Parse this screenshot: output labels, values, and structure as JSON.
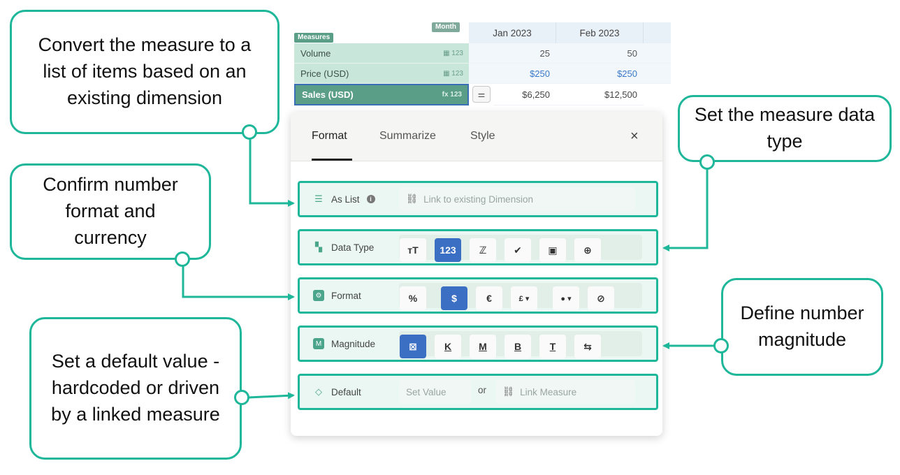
{
  "sheet": {
    "measures_tag": "Measures",
    "month_tag": "Month",
    "columns": [
      "Jan 2023",
      "Feb 2023"
    ],
    "rows": [
      {
        "label": "Volume",
        "icon": "▦ 123",
        "values": [
          "25",
          "50"
        ]
      },
      {
        "label": "Price (USD)",
        "icon": "▦ 123",
        "values": [
          "$250",
          "$250"
        ]
      },
      {
        "label": "Sales (USD)",
        "icon": "fx 123",
        "values": [
          "$6,250",
          "$12,500"
        ]
      }
    ]
  },
  "panel": {
    "tabs": [
      "Format",
      "Summarize",
      "Style"
    ],
    "close": "×",
    "as_list": {
      "label": "As List",
      "placeholder": "Link to existing Dimension"
    },
    "data_type": {
      "label": "Data Type",
      "options": [
        "тТ",
        "123",
        "ℤ",
        "✔",
        "▣",
        "⊕"
      ]
    },
    "format": {
      "label": "Format",
      "options": [
        "%",
        "$",
        "€",
        "£ ▾",
        "● ▾",
        "⊘"
      ]
    },
    "magnitude": {
      "label": "Magnitude",
      "options": [
        "⊠",
        "K",
        "M",
        "B",
        "T",
        "⇆"
      ]
    },
    "default": {
      "label": "Default",
      "set_value": "Set Value",
      "or": "or",
      "link_measure": "Link Measure"
    }
  },
  "callouts": {
    "as_list": "Convert the measure to a list of items based on an existing dimension",
    "data_type": "Set the measure data type",
    "format": "Confirm number format and currency",
    "magnitude": "Define number magnitude",
    "default": "Set a default value - hardcoded or driven by a linked measure"
  },
  "colors": {
    "accent": "#1fb79a",
    "selected": "#3a6fc4",
    "measure_header": "#c8e6d9"
  }
}
